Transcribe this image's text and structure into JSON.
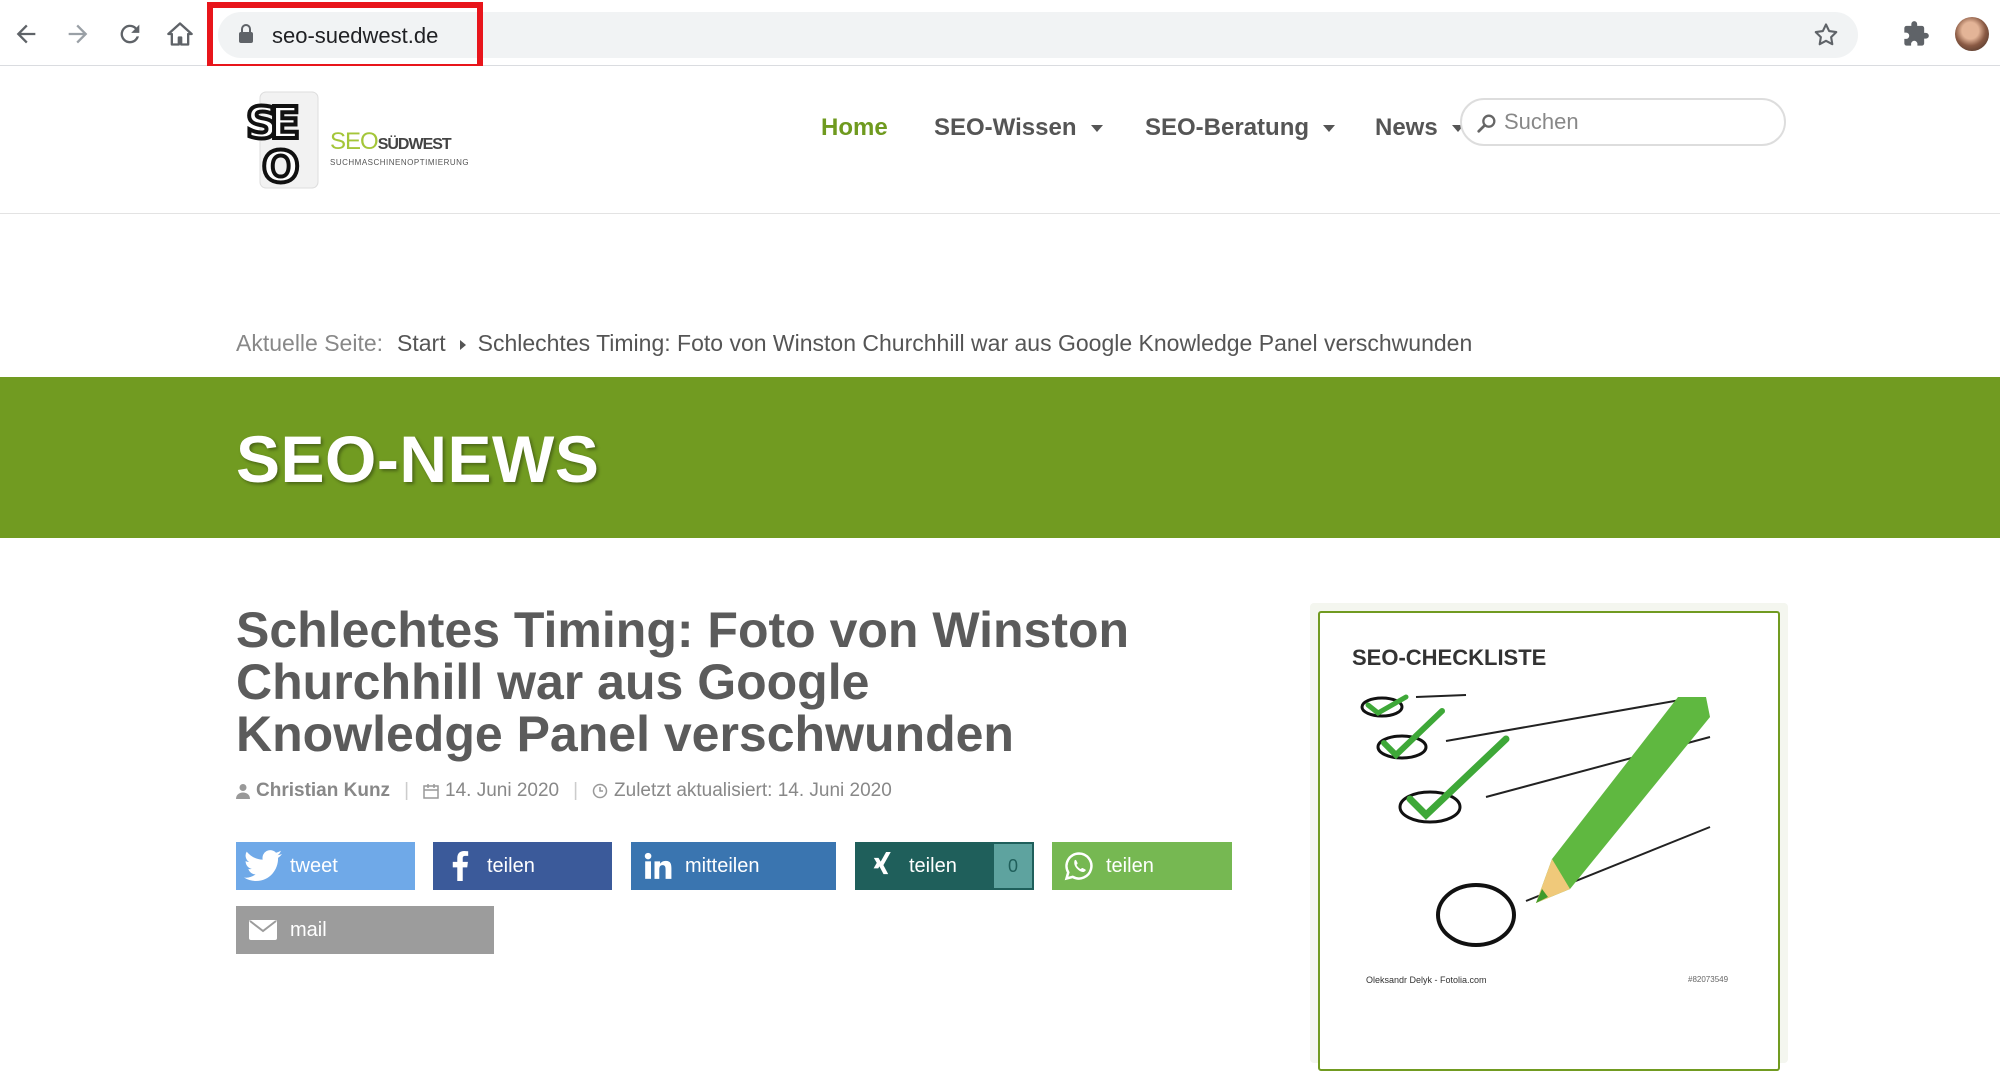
{
  "browser": {
    "url": "seo-suedwest.de"
  },
  "site": {
    "logo": {
      "brand": "SEO",
      "brand_suffix": "SÜDWEST",
      "tagline": "SUCHMASCHINENOPTIMIERUNG"
    },
    "nav": [
      {
        "label": "Home",
        "active": true
      },
      {
        "label": "SEO-Wissen",
        "dropdown": true
      },
      {
        "label": "SEO-Beratung",
        "dropdown": true
      },
      {
        "label": "News",
        "dropdown": true
      }
    ],
    "search_placeholder": "Suchen"
  },
  "breadcrumb": {
    "label": "Aktuelle Seite:",
    "start": "Start",
    "current": "Schlechtes Timing: Foto von Winston Churchhill war aus Google Knowledge Panel verschwunden"
  },
  "section_title": "SEO-NEWS",
  "article": {
    "title": "Schlechtes Timing: Foto von Winston Churchhill war aus Google Knowledge Panel verschwunden",
    "author": "Christian Kunz",
    "date": "14. Juni 2020",
    "updated": "Zuletzt aktualisiert: 14. Juni 2020"
  },
  "share": {
    "twitter": "tweet",
    "facebook": "teilen",
    "linkedin": "mitteilen",
    "xing": "teilen",
    "xing_count": "0",
    "whatsapp": "teilen",
    "mail": "mail"
  },
  "sidebar": {
    "widget_title": "SEO-CHECKLISTE",
    "image_credit": "Oleksandr Delyk - Fotolia.com",
    "image_id": "#82073549"
  },
  "colors": {
    "brand_green": "#719b21",
    "highlight_red": "#e8151b"
  }
}
